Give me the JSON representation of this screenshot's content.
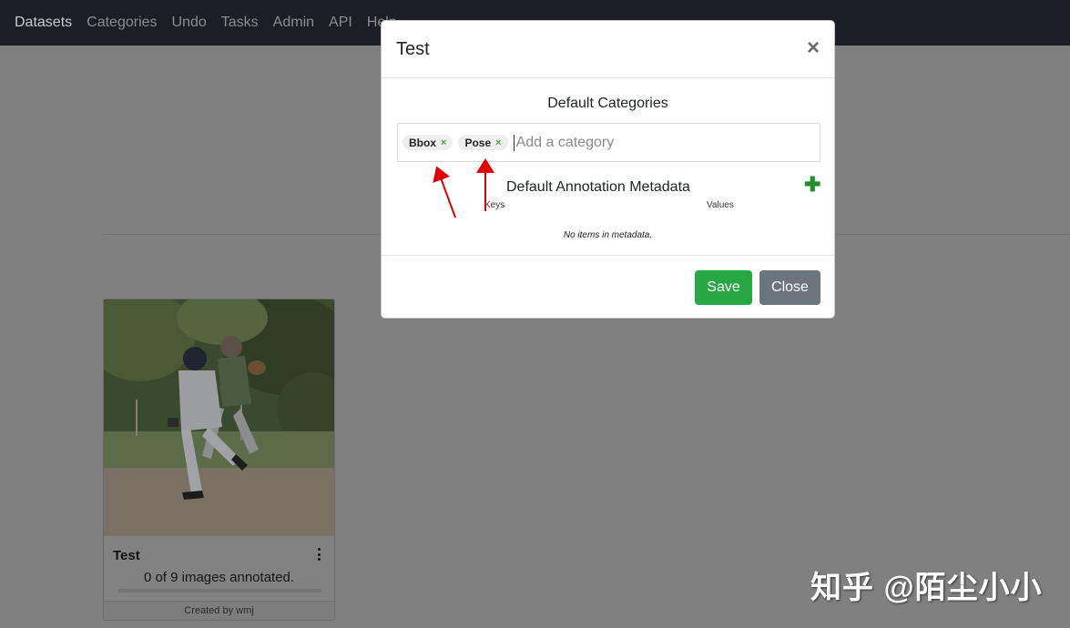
{
  "navbar": {
    "items": [
      {
        "label": "Datasets"
      },
      {
        "label": "Categories"
      },
      {
        "label": "Undo"
      },
      {
        "label": "Tasks"
      },
      {
        "label": "Admin"
      },
      {
        "label": "API"
      },
      {
        "label": "Help"
      }
    ]
  },
  "dataset_card": {
    "title": "Test",
    "count_text": "0 of 9 images annotated.",
    "progress": 0,
    "footer": "Created by wmj"
  },
  "modal": {
    "title": "Test",
    "close_symbol": "×",
    "categories_title": "Default Categories",
    "tags": [
      {
        "label": "Bbox",
        "remove": "×"
      },
      {
        "label": "Pose",
        "remove": "×"
      }
    ],
    "tag_placeholder": "Add a category",
    "metadata_title": "Default Annotation Metadata",
    "add_symbol": "✚",
    "keys_label": "Keys",
    "values_label": "Values",
    "empty_text": "No items in metadata.",
    "save_label": "Save",
    "close_label": "Close"
  },
  "watermark": "知乎 @陌尘小小",
  "colors": {
    "save": "#28a745",
    "close": "#6c757d",
    "add": "#1e8f2a",
    "annotation_arrow": "#e00000"
  },
  "icons": {
    "card_menu": "vertical-dots-icon",
    "add": "plus-icon",
    "modal_close": "close-icon",
    "tag_remove": "close-icon"
  }
}
